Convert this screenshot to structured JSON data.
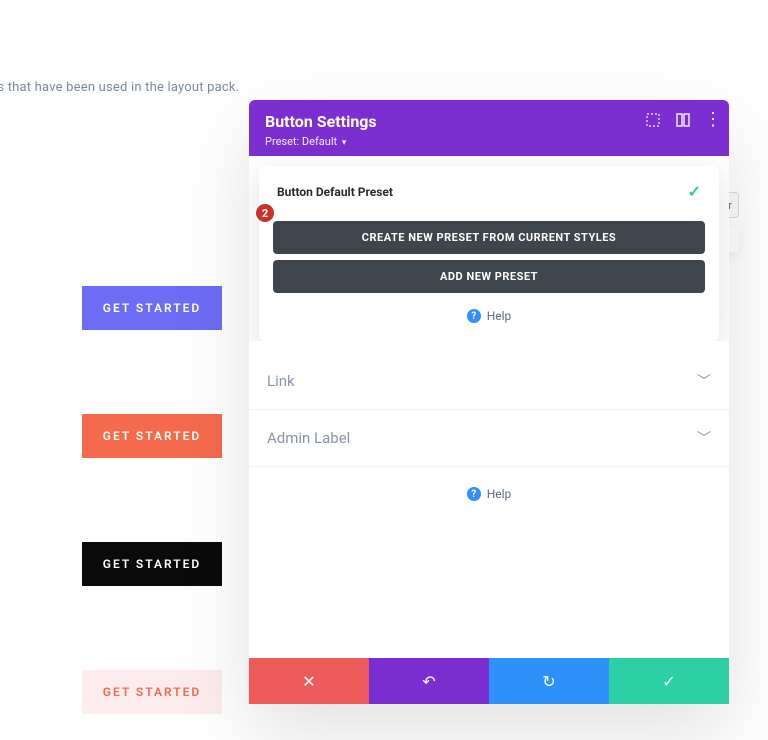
{
  "page": {
    "truncated_text": "ns that have been used in the layout pack."
  },
  "sample_buttons": [
    {
      "label": "GET STARTED"
    },
    {
      "label": "GET STARTED"
    },
    {
      "label": "GET STARTED"
    },
    {
      "label": "GET STARTED"
    }
  ],
  "panel": {
    "title": "Button Settings",
    "preset_label": "Preset: Default",
    "header_icons": {
      "expand": "expand-icon",
      "columns": "columns-icon",
      "kebab": "kebab-icon"
    }
  },
  "preset_dropdown": {
    "current": "Button Default Preset",
    "create_label": "CREATE NEW PRESET FROM CURRENT STYLES",
    "add_label": "ADD NEW PRESET",
    "help_label": "Help"
  },
  "sections": {
    "link": "Link",
    "admin_label": "Admin Label",
    "help_label": "Help"
  },
  "step_badge": "2",
  "ghost_filter": "ter",
  "footer": {
    "close": "close-icon",
    "undo": "undo-icon",
    "redo": "redo-icon",
    "save": "check-icon"
  },
  "colors": {
    "brand_purple": "#7b2fd1",
    "action_red": "#ef5b5b",
    "action_blue": "#2e90fa",
    "action_green": "#2dcfa4",
    "dark_btn": "#3e454d",
    "btn_purple": "#6c6cf5",
    "btn_orange": "#f56a4c",
    "btn_black": "#0b0b0b",
    "btn_pink_bg": "#fdecee"
  }
}
